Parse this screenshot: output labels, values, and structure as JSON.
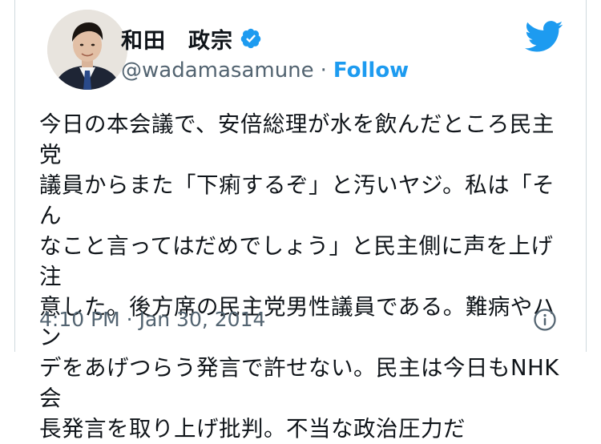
{
  "user": {
    "display_name": "和田　政宗",
    "handle": "@wadamasamune",
    "separator": "·",
    "follow_label": "Follow"
  },
  "tweet": {
    "text": "今日の本会議で、安倍総理が水を飲んだところ民主党\n議員からまた「下痢するぞ」と汚いヤジ。私は「そん\nなこと言ってはだめでしょう」と民主側に声を上げ注\n意した。後方席の民主党男性議員である。難病やハン\nデをあげつらう発言で許せない。民主は今日もNHK会\n長発言を取り上げ批判。不当な政治圧力だ",
    "timestamp": "4:10 PM · Jan 30, 2014"
  },
  "icons": {
    "verified": "verified-badge-icon",
    "brand": "twitter-bird-icon",
    "info": "info-icon"
  },
  "colors": {
    "accent": "#1d9bf0",
    "secondary_text": "#536471",
    "primary_text": "#0f1419",
    "border": "#cfd9de"
  }
}
